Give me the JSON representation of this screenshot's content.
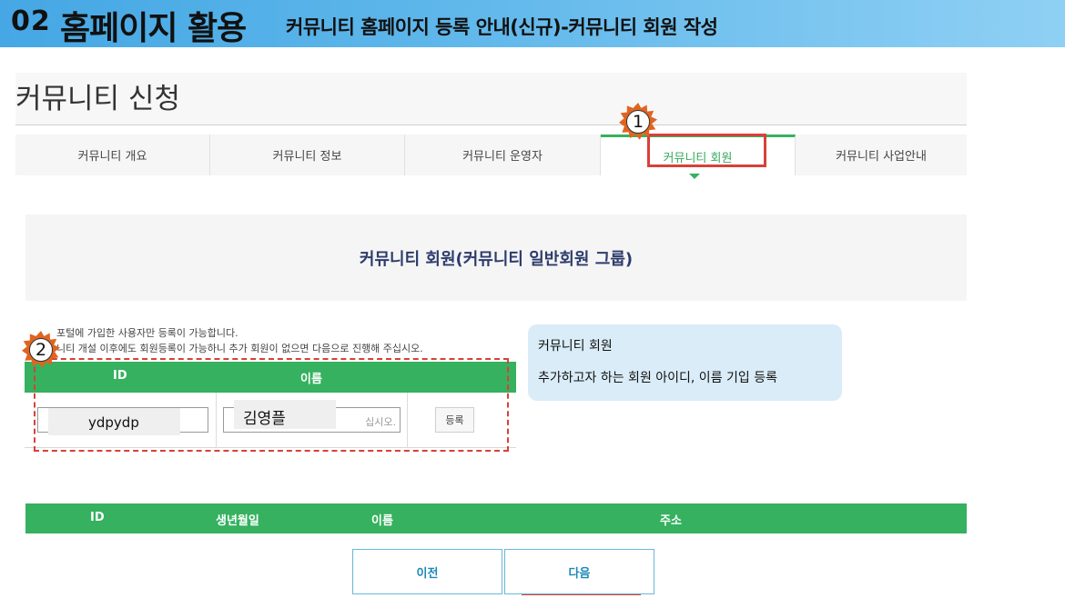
{
  "banner": {
    "number": "02",
    "title": "홈페이지 활용",
    "subtitle": "커뮤니티 홈페이지 등록 안내(신규)-커뮤니티 회원 작성"
  },
  "page": {
    "title": "커뮤니티 신청"
  },
  "tabs": [
    {
      "label": "커뮤니티 개요",
      "active": false
    },
    {
      "label": "커뮤니티 정보",
      "active": false
    },
    {
      "label": "커뮤니티 운영자",
      "active": false
    },
    {
      "label": "커뮤니티 회원",
      "active": true
    },
    {
      "label": "커뮤니티 사업안내",
      "active": false
    }
  ],
  "section": {
    "title": "커뮤니티 회원(커뮤니티 일반회원 그룹)"
  },
  "notes": [
    "포털에 가입한 사용자만 등록이 가능합니다.",
    "니티 개설 이후에도 회원등록이 가능하니 추가 회원이 없으면 다음으로 진행해 주십시오."
  ],
  "member_form": {
    "headers": [
      "ID",
      "이름"
    ],
    "id_value": "ydpydp",
    "name_value": "김영플",
    "name_placeholder_tail": "십시오.",
    "register_label": "등록"
  },
  "tooltip": {
    "line1": "커뮤니티 회원",
    "line2": "추가하고자 하는 회원 아이디, 이름 기입 등록"
  },
  "markers": {
    "one": "1",
    "two": "2"
  },
  "member_list": {
    "headers": [
      "ID",
      "생년월일",
      "이름",
      "주소"
    ]
  },
  "buttons": {
    "prev": "이전",
    "next": "다음"
  },
  "colors": {
    "accent_green": "#35b15f",
    "highlight_red": "#d9403a",
    "banner_blue": "#45a7e4",
    "marker_orange": "#e06420"
  }
}
